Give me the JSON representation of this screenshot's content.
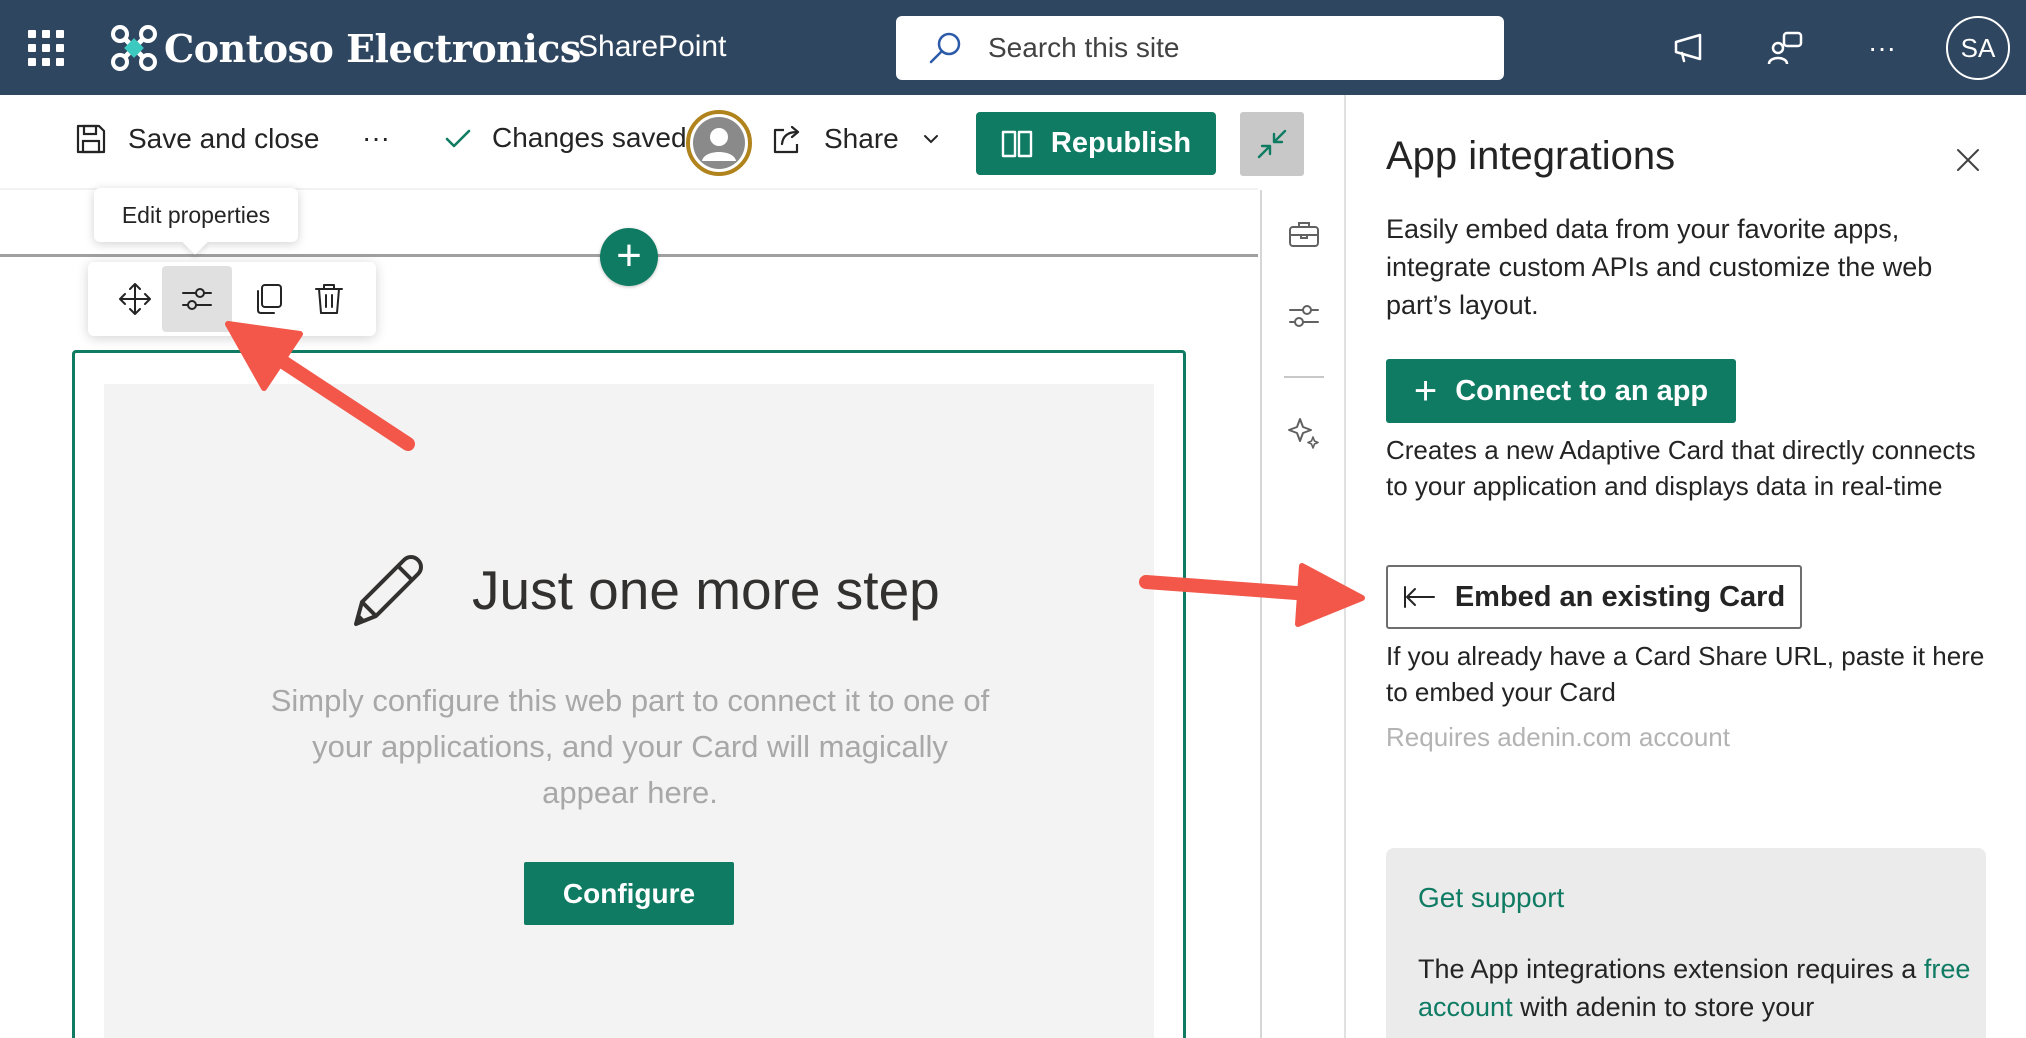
{
  "header": {
    "brand": "Contoso Electronics",
    "app": "SharePoint",
    "search_placeholder": "Search this site",
    "user_initials": "SA"
  },
  "command_bar": {
    "save_close": "Save and close",
    "more": "···",
    "status": "Changes saved",
    "share": "Share",
    "republish": "Republish"
  },
  "canvas": {
    "tooltip": "Edit properties",
    "placeholder_title": "Just one more step",
    "placeholder_description": "Simply configure this web part to connect it to one of your applications, and your Card will magically appear here.",
    "configure": "Configure"
  },
  "panel": {
    "title": "App integrations",
    "intro": "Easily embed data from your favorite apps, integrate custom APIs and customize the web part’s layout.",
    "connect_button": "Connect to an app",
    "connect_desc": "Creates a new Adaptive Card that directly connects to your application and displays data in real-time",
    "embed_button": "Embed an existing Card",
    "embed_desc": "If you already have a Card Share URL, paste it here to embed your Card",
    "requirement": "Requires adenin.com account",
    "support": {
      "title": "Get support",
      "text_before": "The App integrations extension requires a",
      "link": "free account",
      "text_after": "with adenin to store your"
    }
  },
  "colors": {
    "suite_bar": "#2f4660",
    "accent": "#0f7b63",
    "annotation_arrow": "#f2574a"
  }
}
